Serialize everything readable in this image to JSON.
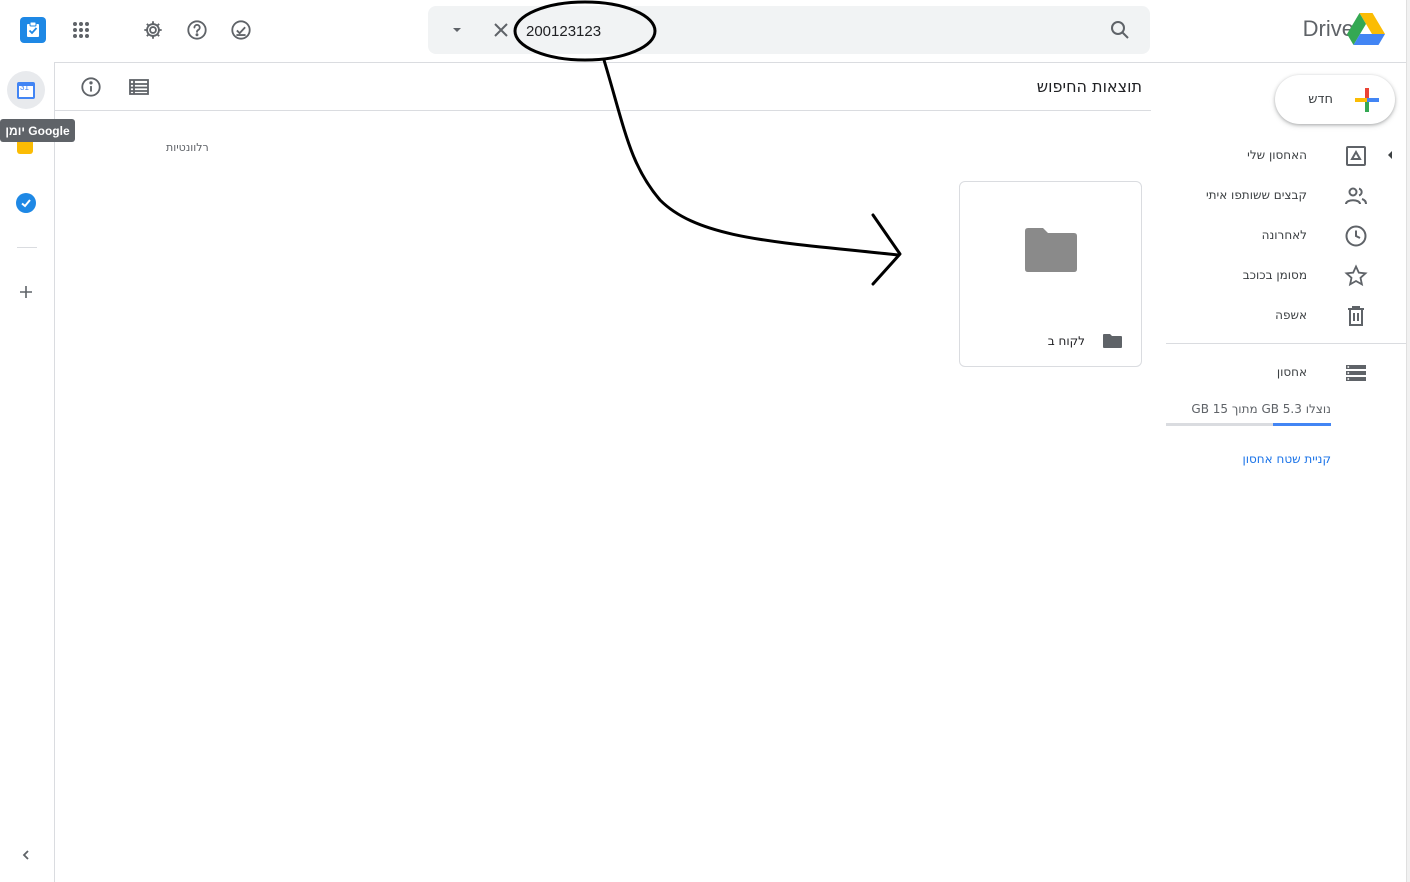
{
  "header": {
    "logo_text": "Drive",
    "search": {
      "value": "200123123"
    }
  },
  "side_panel": {
    "tooltip": "יומן Google",
    "calendar_day": "31"
  },
  "main": {
    "title": "תוצאות החיפוש",
    "sort_label": "רלוונטיות",
    "folder": {
      "name": "לקוח ב"
    }
  },
  "nav": {
    "new_label": "חדש",
    "items": [
      {
        "label": "האחסון שלי"
      },
      {
        "label": "קבצים ששותפו איתי"
      },
      {
        "label": "לאחרונה"
      },
      {
        "label": "מסומן בכוכב"
      },
      {
        "label": "אשפה"
      }
    ],
    "storage_label": "אחסון",
    "storage_text": "נוצלו 5.3 GB מתוך 15 GB",
    "storage_used_fraction": 0.353,
    "buy_storage": "קניית שטח אחסון"
  },
  "colors": {
    "accent_blue": "#1a73e8",
    "google_blue": "#4285f4",
    "tasks_blue": "#1e88e5",
    "keep_yellow": "#fbbc04",
    "folder_gray": "#8a8a8a",
    "icon_gray": "#5f6368"
  }
}
